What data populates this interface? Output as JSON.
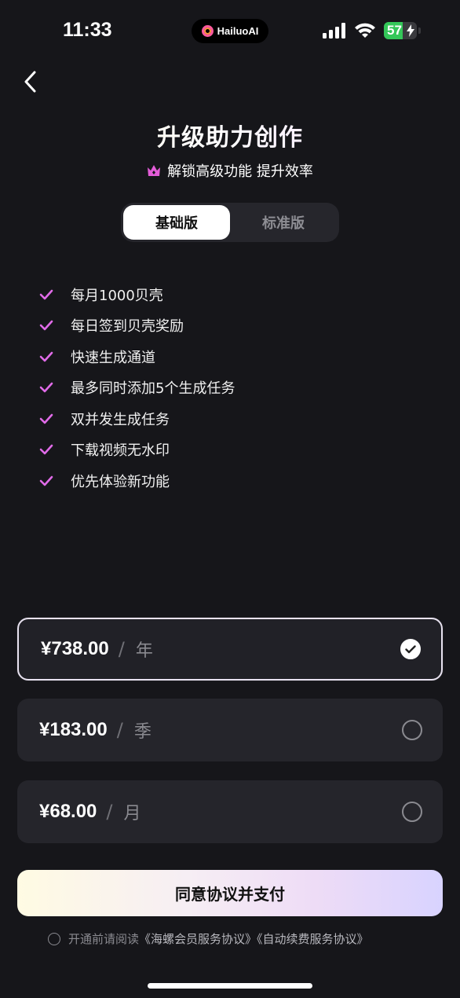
{
  "status_bar": {
    "time": "11:33",
    "island_label": "HailuoAI",
    "battery_level": "57",
    "battery_fraction": 0.57,
    "icons": [
      "signal-icon",
      "wifi-icon",
      "battery-icon"
    ]
  },
  "header": {
    "back_icon": "chevron-left-icon",
    "title": "升级助力创作",
    "subtitle": "解锁高级功能 提升效率",
    "subtitle_icon": "crown-icon"
  },
  "tabs": [
    {
      "label": "基础版",
      "active": true
    },
    {
      "label": "标准版",
      "active": false
    }
  ],
  "features": [
    "每月1000贝壳",
    "每日签到贝壳奖励",
    "快速生成通道",
    "最多同时添加5个生成任务",
    "双并发生成任务",
    "下载视频无水印",
    "优先体验新功能"
  ],
  "plans": [
    {
      "price": "¥738.00",
      "separator": "/",
      "period": "年",
      "selected": true
    },
    {
      "price": "¥183.00",
      "separator": "/",
      "period": "季",
      "selected": false
    },
    {
      "price": "¥68.00",
      "separator": "/",
      "period": "月",
      "selected": false
    }
  ],
  "pay_button": {
    "label": "同意协议并支付"
  },
  "agreement": {
    "prefix": "开通前请阅读",
    "link1": "《海螺会员服务协议》",
    "link2": "《自动续费服务协议》"
  },
  "colors": {
    "background": "#16161a",
    "accent_pink": "#e35cd8",
    "check_pink": "#e06be8"
  }
}
